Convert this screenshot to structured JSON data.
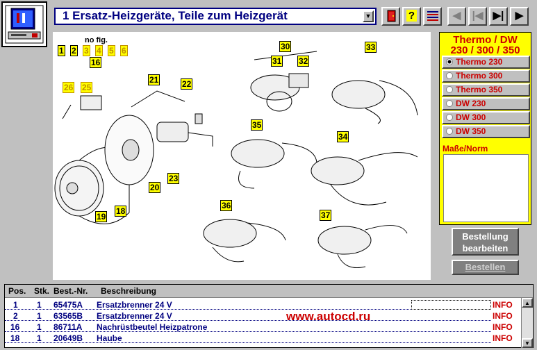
{
  "header": {
    "title": "1 Ersatz-Heizgeräte, Teile zum Heizgerät",
    "toolbar": {
      "help_label": "?",
      "prev_label": "◀",
      "first_label": "|◀",
      "last_label": "▶|",
      "next_label": "▶"
    }
  },
  "diagram": {
    "nofig_label": "no fig.",
    "nofig_numbers": [
      "1",
      "2",
      "3",
      "4",
      "5",
      "6"
    ],
    "callouts": [
      "16",
      "21",
      "22",
      "26",
      "25",
      "20",
      "23",
      "19",
      "18",
      "30",
      "31",
      "32",
      "33",
      "35",
      "34",
      "36",
      "37"
    ]
  },
  "sidepanel": {
    "title_line1": "Thermo / DW",
    "title_line2": "230 / 300 / 350",
    "models": [
      "Thermo 230",
      "Thermo 300",
      "Thermo 350",
      "DW 230",
      "DW 300",
      "DW 350"
    ],
    "selected_index": 0,
    "masse_label": "Maße/Norm",
    "order_edit_line1": "Bestellung",
    "order_edit_line2": "bearbeiten",
    "order_label": "Bestellen"
  },
  "parts": {
    "columns": [
      "Pos.",
      "Stk.",
      "Best.-Nr.",
      "Beschreibung"
    ],
    "rows": [
      {
        "pos": "1",
        "stk": "1",
        "nr": "65475A",
        "desc": "Ersatzbrenner 24 V",
        "info": "INFO"
      },
      {
        "pos": "2",
        "stk": "1",
        "nr": "63565B",
        "desc": "Ersatzbrenner 24 V",
        "info": "INFO"
      },
      {
        "pos": "16",
        "stk": "1",
        "nr": "86711A",
        "desc": "Nachrüstbeutel Heizpatrone",
        "info": "INFO"
      },
      {
        "pos": "18",
        "stk": "1",
        "nr": "20649B",
        "desc": "Haube",
        "info": "INFO"
      }
    ]
  },
  "watermark": "www.autocd.ru",
  "colors": {
    "background": "#c0c0c0",
    "accent_blue": "#000080",
    "accent_red": "#cc0000",
    "callout_yellow": "#ffff00"
  }
}
